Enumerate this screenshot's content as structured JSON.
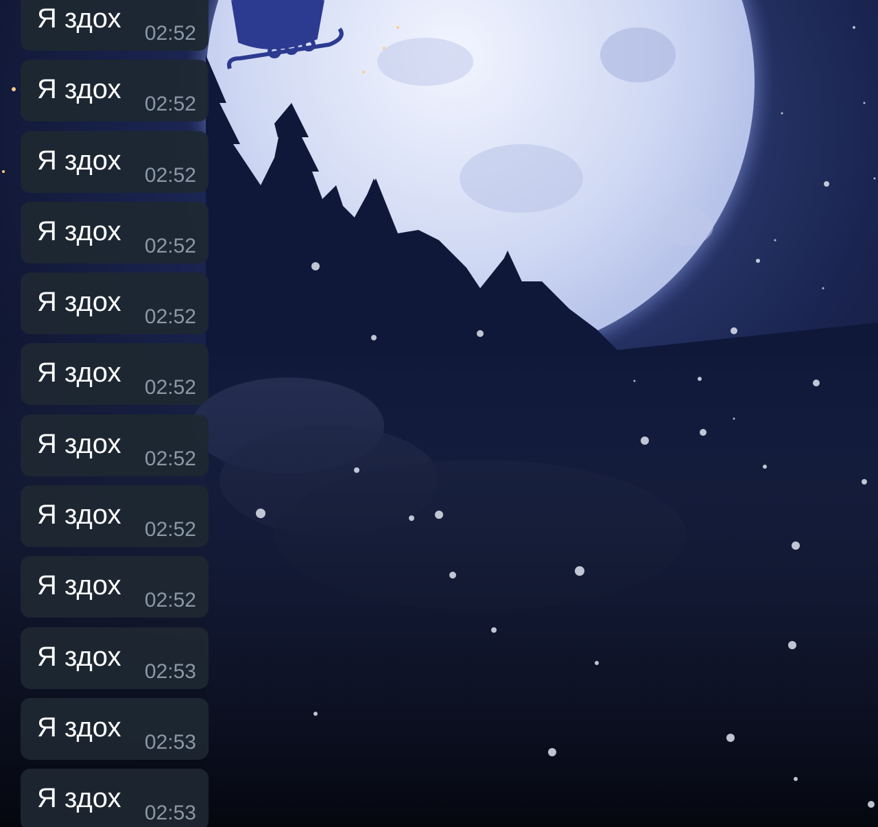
{
  "conversation": {
    "messages": [
      {
        "text": "Я здох",
        "time": "02:52"
      },
      {
        "text": "Я здох",
        "time": "02:52"
      },
      {
        "text": "Я здох",
        "time": "02:52"
      },
      {
        "text": "Я здох",
        "time": "02:52"
      },
      {
        "text": "Я здох",
        "time": "02:52"
      },
      {
        "text": "Я здох",
        "time": "02:52"
      },
      {
        "text": "Я здох",
        "time": "02:52"
      },
      {
        "text": "Я здох",
        "time": "02:52"
      },
      {
        "text": "Я здох",
        "time": "02:52"
      },
      {
        "text": "Я здох",
        "time": "02:53"
      },
      {
        "text": "Я здох",
        "time": "02:53"
      },
      {
        "text": "Я здох",
        "time": "02:53"
      }
    ]
  },
  "theme": {
    "bubble_color": "#1e2832",
    "text_color": "#ffffff",
    "time_color": "#8b98a6",
    "wallpaper": "night-sky-full-moon-pine-forest-sleigh"
  }
}
